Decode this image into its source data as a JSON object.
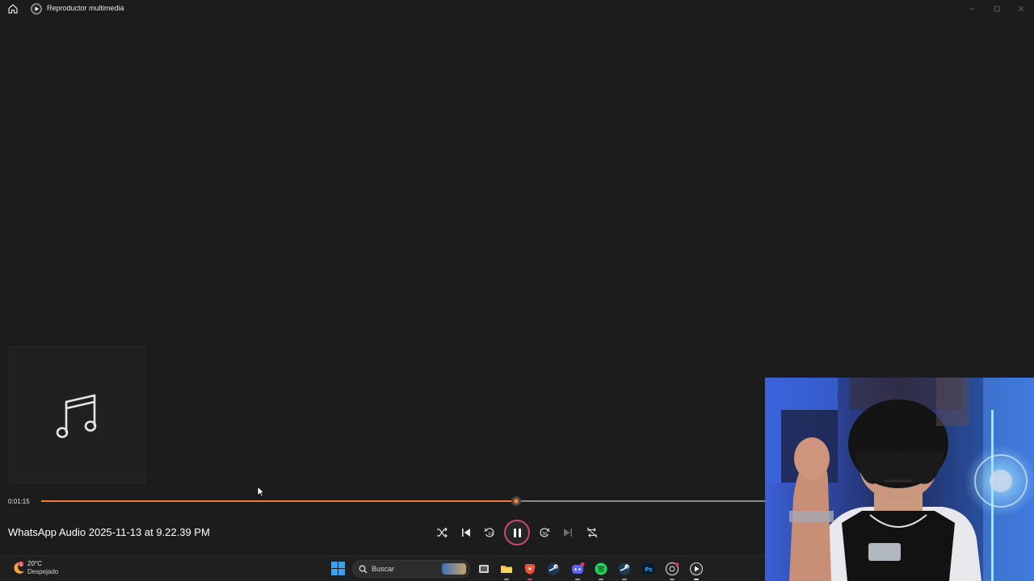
{
  "window": {
    "title": "Reproductor multimedia"
  },
  "player": {
    "current_time": "0:01:15",
    "progress": 0.656,
    "track_title": "WhatsApp Audio 2025-11-13 at 9.22.39 PM",
    "state": "playing"
  },
  "colors": {
    "accent": "#ef7a3a",
    "play_ring": "#c9467a",
    "background": "#1c1c1c"
  },
  "taskbar": {
    "weather": {
      "temp": "20°C",
      "condition": "Despejado",
      "badge": "1"
    },
    "search": {
      "label": "Buscar"
    },
    "apps": [
      "file-explorer-icon",
      "brave-browser-icon",
      "steam-icon",
      "discord-icon",
      "spotify-icon",
      "steam-icon",
      "photoshop-icon",
      "chrome-icon",
      "media-player-icon"
    ]
  },
  "photoshop_label": "Ps"
}
